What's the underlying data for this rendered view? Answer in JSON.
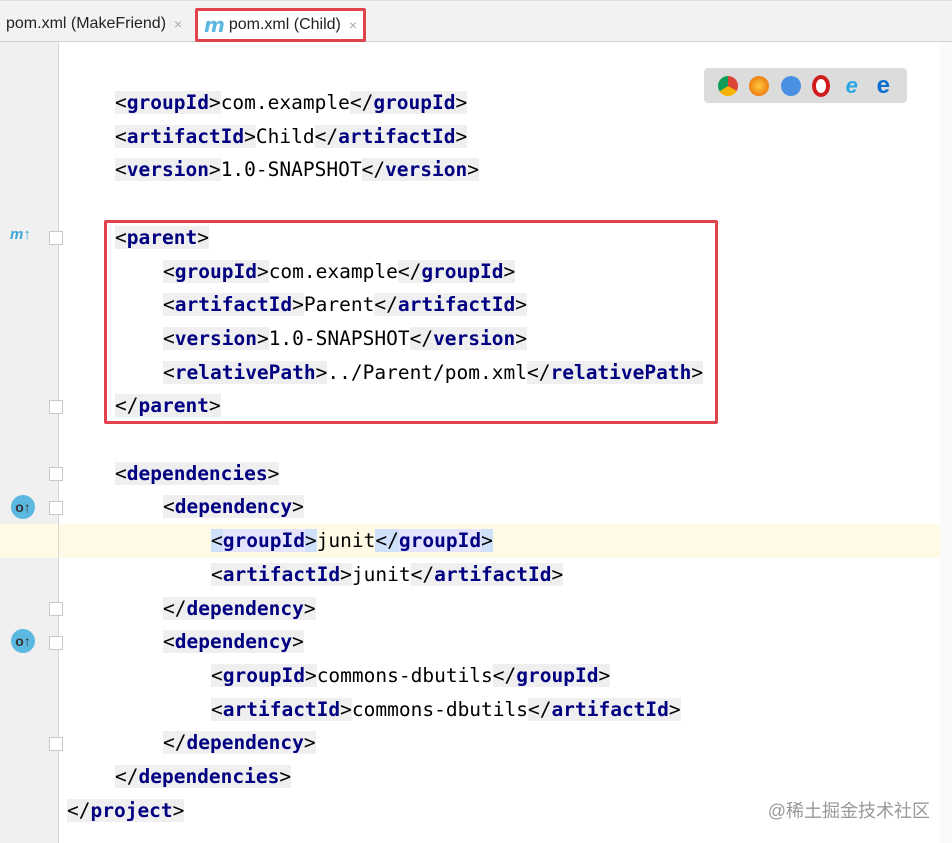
{
  "tabs": [
    {
      "label": "pom.xml (MakeFriend)",
      "close": "×"
    },
    {
      "label": "pom.xml (Child)",
      "close": "×",
      "icon": "m"
    }
  ],
  "browsers": [
    "chrome",
    "firefox",
    "safari",
    "opera",
    "ie",
    "edge"
  ],
  "gutter_icons": {
    "parent": "m↑",
    "override": "o↑"
  },
  "lines": [
    {
      "i": 1,
      "s": [
        [
          "tag",
          "groupId"
        ],
        [
          "text",
          "com.example"
        ],
        [
          "end",
          "groupId"
        ]
      ]
    },
    {
      "i": 1,
      "s": [
        [
          "tag",
          "artifactId"
        ],
        [
          "text",
          "Child"
        ],
        [
          "end",
          "artifactId"
        ]
      ]
    },
    {
      "i": 1,
      "s": [
        [
          "tag",
          "version"
        ],
        [
          "text",
          "1.0-SNAPSHOT"
        ],
        [
          "end",
          "version"
        ]
      ]
    },
    {
      "i": 1,
      "s": []
    },
    {
      "i": 1,
      "s": [
        [
          "tag",
          "parent"
        ]
      ]
    },
    {
      "i": 2,
      "s": [
        [
          "tag",
          "groupId"
        ],
        [
          "text",
          "com.example"
        ],
        [
          "end",
          "groupId"
        ]
      ]
    },
    {
      "i": 2,
      "s": [
        [
          "tag",
          "artifactId"
        ],
        [
          "text",
          "Parent"
        ],
        [
          "end",
          "artifactId"
        ]
      ]
    },
    {
      "i": 2,
      "s": [
        [
          "tag",
          "version"
        ],
        [
          "text",
          "1.0-SNAPSHOT"
        ],
        [
          "end",
          "version"
        ]
      ]
    },
    {
      "i": 2,
      "s": [
        [
          "tag",
          "relativePath"
        ],
        [
          "text",
          "../Parent/pom.xml"
        ],
        [
          "end",
          "relativePath"
        ]
      ]
    },
    {
      "i": 1,
      "s": [
        [
          "end",
          "parent"
        ]
      ]
    },
    {
      "i": 1,
      "s": []
    },
    {
      "i": 1,
      "s": [
        [
          "tag",
          "dependencies"
        ]
      ]
    },
    {
      "i": 2,
      "s": [
        [
          "tag",
          "dependency"
        ]
      ]
    },
    {
      "i": 3,
      "s": [
        [
          "tag",
          "groupId"
        ],
        [
          "text",
          "junit"
        ],
        [
          "end",
          "groupId"
        ]
      ],
      "hl": true
    },
    {
      "i": 3,
      "s": [
        [
          "tag",
          "artifactId"
        ],
        [
          "text",
          "junit"
        ],
        [
          "end",
          "artifactId"
        ]
      ]
    },
    {
      "i": 2,
      "s": [
        [
          "end",
          "dependency"
        ]
      ]
    },
    {
      "i": 2,
      "s": [
        [
          "tag",
          "dependency"
        ]
      ]
    },
    {
      "i": 3,
      "s": [
        [
          "tag",
          "groupId"
        ],
        [
          "text",
          "commons-dbutils"
        ],
        [
          "end",
          "groupId"
        ]
      ]
    },
    {
      "i": 3,
      "s": [
        [
          "tag",
          "artifactId"
        ],
        [
          "text",
          "commons-dbutils"
        ],
        [
          "end",
          "artifactId"
        ]
      ]
    },
    {
      "i": 2,
      "s": [
        [
          "end",
          "dependency"
        ]
      ]
    },
    {
      "i": 1,
      "s": [
        [
          "end",
          "dependencies"
        ]
      ]
    },
    {
      "i": 0,
      "s": [
        [
          "end",
          "project"
        ]
      ]
    }
  ],
  "watermark": "@稀土掘金技术社区"
}
